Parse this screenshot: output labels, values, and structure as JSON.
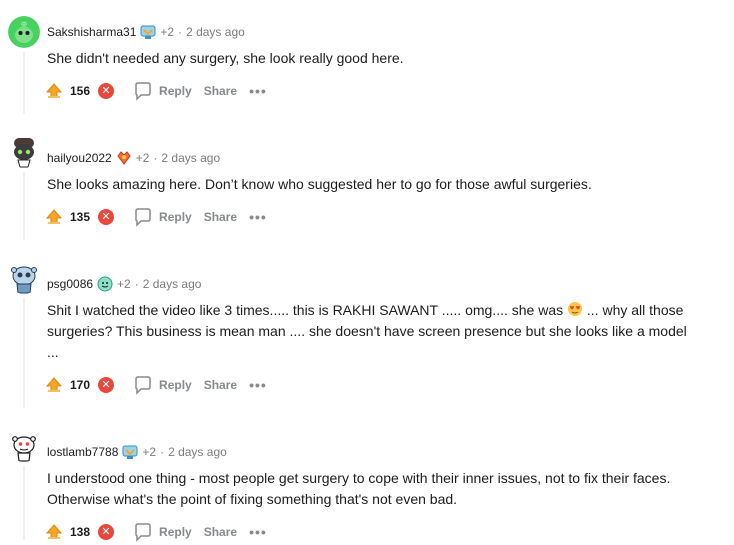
{
  "comments": [
    {
      "username": "Sakshisharma31",
      "award_count": "+2",
      "separator": "·",
      "time": "2 days ago",
      "body": "She didn't needed any surgery, she look really good here.",
      "score": "156",
      "reply_label": "Reply",
      "share_label": "Share",
      "more_label": "•••",
      "avatar_icon": "avatar-green-alien-icon",
      "award_icon": "award-icon"
    },
    {
      "username": "hailyou2022",
      "award_count": "+2",
      "separator": "·",
      "time": "2 days ago",
      "body": "She looks amazing here. Don’t know who suggested her to go for those awful surgeries.",
      "score": "135",
      "reply_label": "Reply",
      "share_label": "Share",
      "more_label": "•••",
      "avatar_icon": "avatar-snoo-dark-icon",
      "award_icon": "award-icon"
    },
    {
      "username": "psg0086",
      "award_count": "+2",
      "separator": "·",
      "time": "2 days ago",
      "body_parts": [
        "Shit I watched the video like 3 times..... this is RAKHI SAWANT ..... omg.... she was ",
        " ... why all those surgeries? This business is mean man .... she doesn't have screen presence but she looks like a model ..."
      ],
      "score": "170",
      "reply_label": "Reply",
      "share_label": "Share",
      "more_label": "•••",
      "avatar_icon": "avatar-snoo-blue-icon",
      "award_icon": "award-icon",
      "emoji_icon": "heart-eyes-emoji-icon"
    },
    {
      "username": "lostlamb7788",
      "award_count": "+2",
      "separator": "·",
      "time": "2 days ago",
      "body": "I understood one thing - most people get surgery to cope with their inner issues, not to fix their faces. Otherwise what's the point of fixing something that's not even bad.",
      "score": "138",
      "reply_label": "Reply",
      "share_label": "Share",
      "more_label": "•••",
      "avatar_icon": "avatar-snoo-white-icon",
      "award_icon": "award-icon"
    }
  ],
  "colors": {
    "upvote": "#f5a623",
    "downvote": "#e8473b",
    "meta_gray": "#7c7c7c",
    "action_gray": "#878a8c"
  }
}
